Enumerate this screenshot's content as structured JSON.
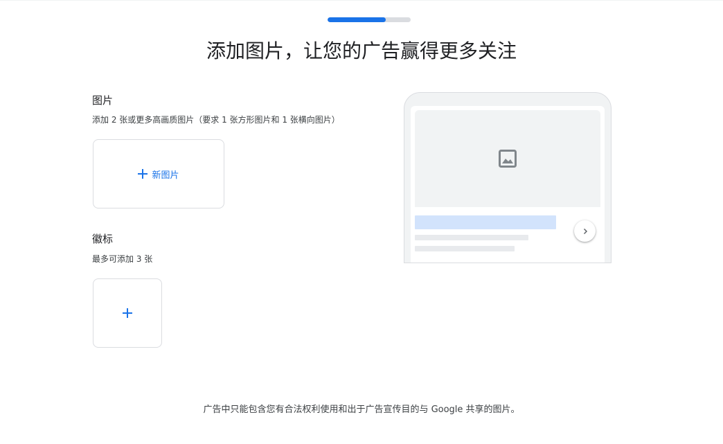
{
  "progress": {
    "value_fraction": 0.7,
    "accent_color": "#1a73e8",
    "track_color": "#dadce0"
  },
  "header": {
    "title": "添加图片，让您的广告赢得更多关注"
  },
  "images_section": {
    "title": "图片",
    "description": "添加 2 张或更多高画质图片（要求 1 张方形图片和 1 张横向图片）",
    "add_button_label": "新图片",
    "add_icon": "plus-icon"
  },
  "logos_section": {
    "title": "徽标",
    "description": "最多可添加 3 张",
    "add_icon": "plus-icon"
  },
  "preview": {
    "image_placeholder_icon": "image-icon",
    "next_icon": "chevron-right-icon",
    "headline_bar_color": "#d2e3fc",
    "text_bar_color": "#e8eaed"
  },
  "footer": {
    "text": "广告中只能包含您有合法权利使用和出于广告宣传目的与 Google 共享的图片。"
  }
}
